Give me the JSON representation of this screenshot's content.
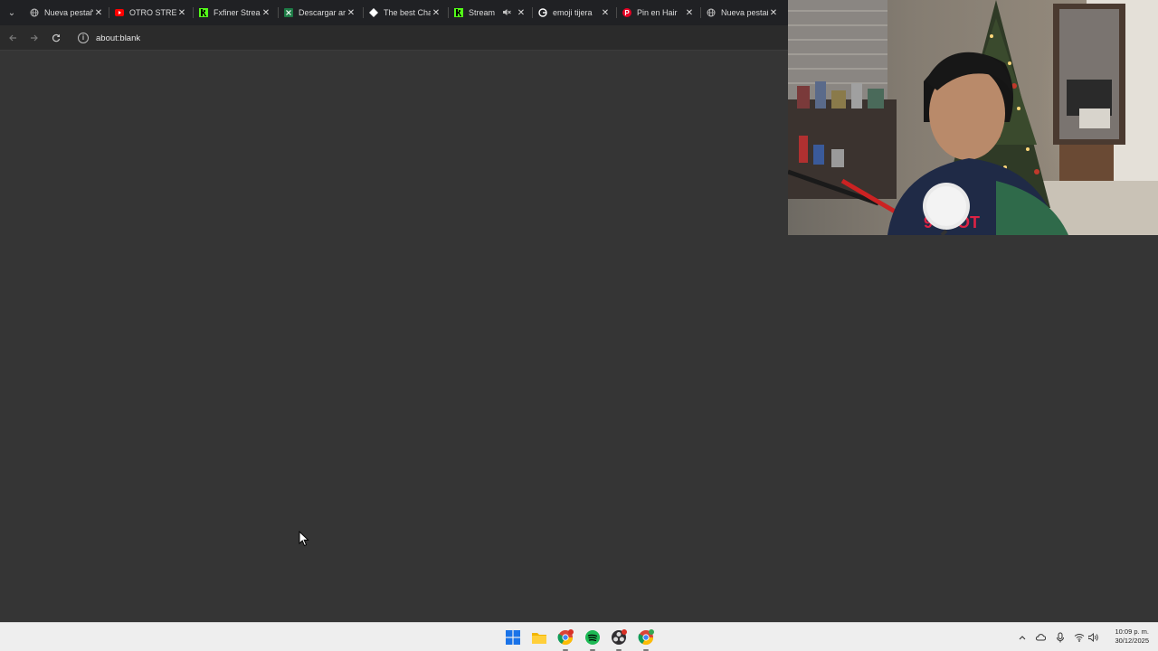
{
  "tabs": [
    {
      "title": "Nueva pestaña",
      "favicon": "globe-icon",
      "color": "#bdbdbd"
    },
    {
      "title": "OTRO STREAM",
      "favicon": "youtube-icon",
      "color": "#ff0000"
    },
    {
      "title": "Fxfiner Stream",
      "favicon": "kick-icon",
      "color": "#53fc18"
    },
    {
      "title": "Descargar ar",
      "favicon": "excel-icon",
      "color": "#1d7a45"
    },
    {
      "title": "The best Cha",
      "favicon": "diamond-icon",
      "color": "#ffffff"
    },
    {
      "title": "Stream",
      "favicon": "kick-icon",
      "color": "#53fc18",
      "muted": true
    },
    {
      "title": "emoji tijera",
      "favicon": "google-icon",
      "color": "#ffffff"
    },
    {
      "title": "Pin en Hair",
      "favicon": "pinterest-icon",
      "color": "#e60023"
    },
    {
      "title": "Nueva pestaña",
      "favicon": "globe-icon",
      "color": "#bdbdbd"
    }
  ],
  "toolbar": {
    "url": "about:blank"
  },
  "taskbar": {
    "apps": [
      "windows-start-icon",
      "file-explorer-icon",
      "chrome-icon",
      "spotify-icon",
      "obs-icon",
      "chrome-alt-icon"
    ],
    "time": "10:09 p. m.",
    "date": "30/12/2025"
  },
  "colors": {
    "page_bg": "#353535",
    "tabstrip_bg": "#202124",
    "toolbar_bg": "#2b2b2b",
    "taskbar_bg": "#eeeeee"
  }
}
